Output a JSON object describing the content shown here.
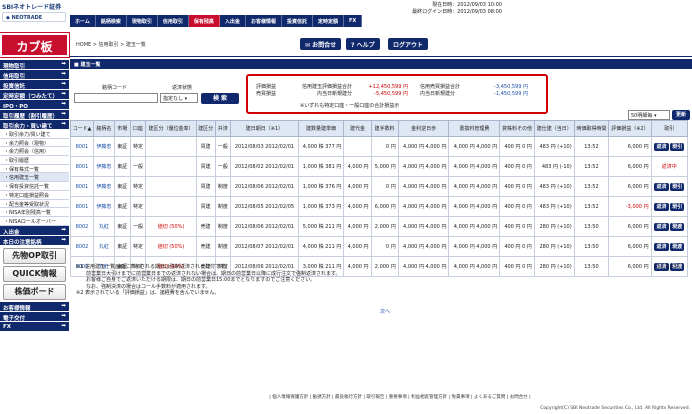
{
  "header": {
    "logo_main": "SBIネオトレード証券",
    "logo_sub": "NEOTRADE",
    "date_current": "現在日時：2012/09/03 10:00",
    "date_login": "最終ログイン日時：2012/09/03 08:00",
    "nav": [
      "ホーム",
      "銘柄検索",
      "現物取引",
      "信用取引",
      "保有残高",
      "入出金",
      "お客様情報",
      "投資信託",
      "定時定額",
      "FX"
    ],
    "active_nav": "保有残高"
  },
  "brand": "カブ板",
  "breadcrumb": "HOME > 信用取引 > 建玉一覧",
  "header_buttons": {
    "contact": "お問合せ",
    "help": "ヘルプ",
    "logout": "ログアウト"
  },
  "sidebar": {
    "items": [
      {
        "label": "現物取引"
      },
      {
        "label": "信用取引"
      },
      {
        "label": "投資信託"
      },
      {
        "label": "定時定額（つみたて）"
      },
      {
        "label": "IPO・PO"
      },
      {
        "label": "取引履歴（割引履歴）"
      },
      {
        "label": "取引余力・買い建て"
      }
    ],
    "subs": [
      "取引余力/買い建て",
      "余力照会（現物）",
      "余力照会（信用）",
      "取引履歴",
      "保有株式一覧",
      "信用建玉一覧",
      "保有投資信託一覧",
      "特定口座損益照会",
      "配当金等受取状況",
      "NISA年別残高一覧",
      "NISAロールオーバー"
    ],
    "active_sub": "信用建玉一覧",
    "items2": [
      {
        "label": "入出金"
      },
      {
        "label": "本日の注意銘柄"
      }
    ],
    "bigbuttons": [
      "先物OP取引",
      "QUICK情報",
      "株価ボード"
    ],
    "items3": [
      {
        "label": "お客様情報"
      },
      {
        "label": "電子交付"
      },
      {
        "label": "FX"
      }
    ]
  },
  "page_title": "建玉一覧",
  "filter": {
    "code_label": "銘柄コード",
    "status_label": "返済状態",
    "status_value": "指定なし",
    "search_button": "検 索"
  },
  "summary": {
    "eval_label": "評価損益",
    "eval_label2": "売買損益",
    "total_unrealized_label": "信用建玉評価損益合計",
    "total_unrealized": "+12,450,599 円",
    "today_unrealized_label": "内当日新規建分",
    "today_unrealized": "-5,450,599 円",
    "sell_label": "信用売買損益合計",
    "sell_value": "-3,450,599 円",
    "sell_today_label": "内当日新規建分",
    "sell_today": "-1,450,599 円",
    "note": "※いずれも特定口座・一般口座の合計損益示"
  },
  "sort": {
    "selected": "50明細毎",
    "button": "更新"
  },
  "table": {
    "headers": [
      "コード▲",
      "銘柄名",
      "市場",
      "口座",
      "建区分（優位金率）",
      "建区分",
      "弁済",
      "建日期日（※1）",
      "建数量建単価",
      "建代金",
      "建手数料",
      "金利逆日歩",
      "書換料管理費",
      "貸株料その他",
      "建仕建（当日）",
      "時価取得時間",
      "評価損益（※2）",
      "取引"
    ],
    "rows": [
      {
        "code": "8001",
        "name": "伊藤忠",
        "mkt": "東証",
        "acct": "特定",
        "rate": "",
        "kind": "買建",
        "pay": "一般",
        "date": "2012/08/03 2012/02/01",
        "qty": "4,000 株 377 円",
        "amt": "",
        "fee": "0 円",
        "int": "4,000 円 4,000 円",
        "rew": "4,000 円 4,000 円",
        "lend": "400 円 0 円",
        "tp": "483 円 (+10)",
        "time": "13:52",
        "pl": "6,000 円",
        "act": "返済 現引"
      },
      {
        "code": "8001",
        "name": "伊藤忠",
        "mkt": "東証",
        "acct": "一般",
        "rate": "",
        "kind": "買建",
        "pay": "一般",
        "date": "2012/08/02 2012/02/01",
        "qty": "1,000 株 381 円",
        "amt": "4,000 円",
        "fee": "5,000 円",
        "int": "4,000 円 4,000 円",
        "rew": "4,000 円 4,000 円",
        "lend": "400 円 0 円",
        "tp": "483 円 (-10)",
        "time": "13:52",
        "pl": "6,000 円",
        "act": "返済中"
      },
      {
        "code": "8001",
        "name": "伊藤忠",
        "mkt": "東証",
        "acct": "特定",
        "rate": "",
        "kind": "買建",
        "pay": "制度",
        "date": "2012/08/06 2012/02/01",
        "qty": "1,000 株 376 円",
        "amt": "4,000 円",
        "fee": "0 円",
        "int": "4,000 円 4,000 円",
        "rew": "4,000 円 4,000 円",
        "lend": "400 円 0 円",
        "tp": "483 円 (+10)",
        "time": "13:52",
        "pl": "6,000 円",
        "act": "返済 現引"
      },
      {
        "code": "8001",
        "name": "伊藤忠",
        "mkt": "東証",
        "acct": "特定",
        "rate": "",
        "kind": "買建",
        "pay": "制度",
        "date": "2012/08/05 2012/02/05",
        "qty": "1,000 株 373 円",
        "amt": "4,000 円",
        "fee": "6,000 円",
        "int": "4,000 円 4,000 円",
        "rew": "4,000 円 4,000 円",
        "lend": "400 円 0 円",
        "tp": "483 円 (+10)",
        "time": "13:52",
        "pl": "-3,000 円",
        "act": "返済 現引"
      },
      {
        "code": "8002",
        "name": "丸紅",
        "mkt": "東証",
        "acct": "一般",
        "rate": "値切 (50%)",
        "kind": "売建",
        "pay": "制度",
        "date": "2012/08/06 2012/02/01",
        "qty": "5,000 株 211 円",
        "amt": "4,000 円",
        "fee": "2,000 円",
        "int": "4,000 円 4,000 円",
        "rew": "4,000 円 4,000 円",
        "lend": "400 円 0 円",
        "tp": "280 円 (+10)",
        "time": "13:50",
        "pl": "6,000 円",
        "act": "返済 現渡"
      },
      {
        "code": "8002",
        "name": "丸紅",
        "mkt": "東証",
        "acct": "特定",
        "rate": "値切 (50%)",
        "kind": "売建",
        "pay": "制度",
        "date": "2012/08/07 2012/02/01",
        "qty": "4,000 株 211 円",
        "amt": "4,000 円",
        "fee": "0 円",
        "int": "4,000 円 4,000 円",
        "rew": "4,000 円 4,000 円",
        "lend": "400 円 0 円",
        "tp": "280 円 (+10)",
        "time": "13:50",
        "pl": "6,000 円",
        "act": "返済 現渡"
      },
      {
        "code": "8002",
        "name": "丸紅",
        "mkt": "東証",
        "acct": "特定",
        "rate": "値切 (60%)",
        "kind": "売建",
        "pay": "制度",
        "date": "2012/08/06 2012/02/01",
        "qty": "3,000 株 211 円",
        "amt": "4,000 円",
        "fee": "2,000 円",
        "int": "4,000 円 4,000 円",
        "rew": "4,000 円 4,000 円",
        "lend": "400 円 0 円",
        "tp": "280 円 (+10)",
        "time": "13:50",
        "pl": "6,000 円",
        "act": "返済 現渡"
      }
    ]
  },
  "pagination": "| 1 | 2 | 3 |",
  "notes": [
    "※1 信用建玉一覧画面に表示される期日は強制返済される日付です。",
    "　　前営業日大引けまでに前営業日までの返済されない場合は、期日の前営業日以降に成行注文で強制返済されます。",
    "　　お客様ご自身でご返済いただける期限は、期日の前営業日15:00までとなりますのでご注意ください。",
    "　　なお、強制決済の場合はコール手数料が適用されます。",
    "※2 表示されている「評価損益」は、諸経費を含んでいません。"
  ],
  "next_link": "次へ",
  "footer_links": "| 個人情報保護方針 | 勧誘方針 | 最良執行方針 | 取引報告 | 重要事項 | 利益相反管理方針 | 免責事項 | よくあるご質問 | お問合せ |",
  "copyright": "Copyright(C) SBI Neotrade Securities Co., Ltd. All Rights Reserved."
}
